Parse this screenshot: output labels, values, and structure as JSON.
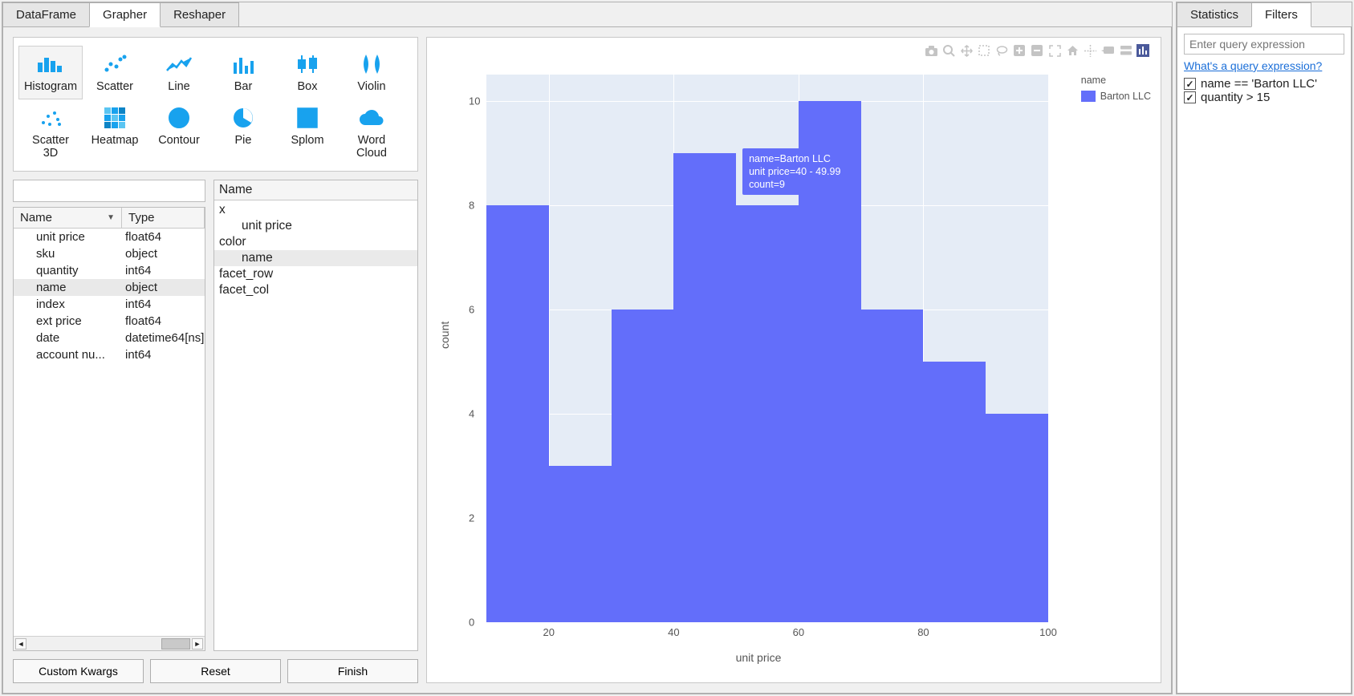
{
  "tabs_main": [
    "DataFrame",
    "Grapher",
    "Reshaper"
  ],
  "tabs_main_active": 1,
  "chart_types": [
    {
      "label": "Histogram",
      "icon": "histogram",
      "selected": true
    },
    {
      "label": "Scatter",
      "icon": "scatter"
    },
    {
      "label": "Line",
      "icon": "line"
    },
    {
      "label": "Bar",
      "icon": "bar"
    },
    {
      "label": "Box",
      "icon": "box"
    },
    {
      "label": "Violin",
      "icon": "violin"
    },
    {
      "label": "Scatter 3D",
      "icon": "scatter3d"
    },
    {
      "label": "Heatmap",
      "icon": "heatmap"
    },
    {
      "label": "Contour",
      "icon": "contour"
    },
    {
      "label": "Pie",
      "icon": "pie"
    },
    {
      "label": "Splom",
      "icon": "splom"
    },
    {
      "label": "Word Cloud",
      "icon": "cloud"
    }
  ],
  "column_grid": {
    "headers": [
      "Name",
      "Type"
    ],
    "rows": [
      {
        "name": "unit price",
        "type": "float64"
      },
      {
        "name": "sku",
        "type": "object"
      },
      {
        "name": "quantity",
        "type": "int64"
      },
      {
        "name": "name",
        "type": "object",
        "selected": true
      },
      {
        "name": "index",
        "type": "int64"
      },
      {
        "name": "ext price",
        "type": "float64"
      },
      {
        "name": "date",
        "type": "datetime64[ns]"
      },
      {
        "name": "account nu...",
        "type": "int64"
      }
    ]
  },
  "drag_tree": {
    "header": "Name",
    "nodes": [
      {
        "root": "x",
        "child": "unit price"
      },
      {
        "root": "color",
        "child": "name",
        "child_selected": true
      },
      {
        "root": "facet_row"
      },
      {
        "root": "facet_col"
      }
    ]
  },
  "buttons": {
    "custom": "Custom Kwargs",
    "reset": "Reset",
    "finish": "Finish"
  },
  "chart_data": {
    "type": "bar",
    "xlabel": "unit price",
    "ylabel": "count",
    "x_edges": [
      10,
      20,
      30,
      40,
      50,
      60,
      70,
      80,
      90,
      100
    ],
    "values": [
      8,
      3,
      6,
      9,
      8,
      10,
      6,
      5,
      4
    ],
    "x_ticks": [
      20,
      40,
      60,
      80,
      100
    ],
    "y_ticks": [
      0,
      2,
      4,
      6,
      8,
      10
    ],
    "ylim": [
      0,
      10.5
    ],
    "xlim": [
      10,
      100
    ],
    "color": "#636efa",
    "series_name": "Barton LLC",
    "legend_title": "name",
    "tooltip": {
      "name": "name=Barton LLC",
      "bin": "unit price=40 - 49.99",
      "count": "count=9",
      "at_bar_index": 3
    }
  },
  "modebar_icons": [
    "camera",
    "zoom",
    "pan",
    "select",
    "lasso",
    "zoomin",
    "zoomout",
    "autoscale",
    "home",
    "spike",
    "hover",
    "compare",
    "plotly"
  ],
  "side_tabs": [
    "Statistics",
    "Filters"
  ],
  "side_tabs_active": 1,
  "filter_panel": {
    "placeholder": "Enter query expression",
    "help_link": "What's a query expression?",
    "filters": [
      {
        "checked": true,
        "expr": "name == 'Barton LLC'"
      },
      {
        "checked": true,
        "expr": "quantity > 15"
      }
    ]
  }
}
